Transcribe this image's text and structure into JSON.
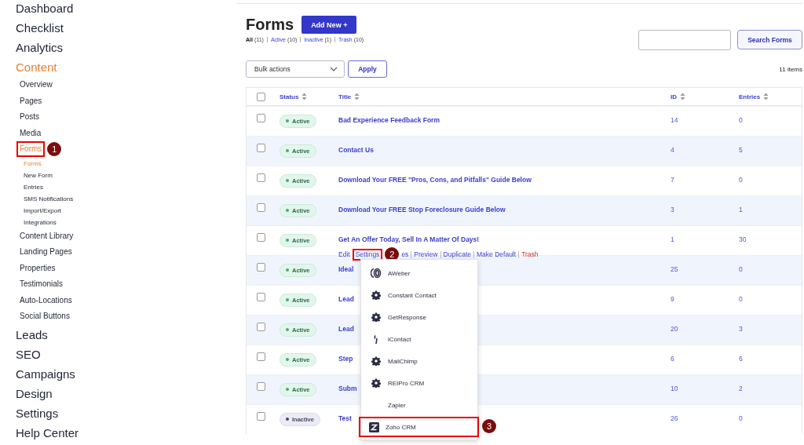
{
  "sidebar": {
    "items": [
      {
        "label": "Dashboard",
        "selected": false
      },
      {
        "label": "Checklist",
        "selected": false
      },
      {
        "label": "Analytics",
        "selected": false
      },
      {
        "label": "Content",
        "selected": true,
        "children": [
          {
            "label": "Overview",
            "selected": false
          },
          {
            "label": "Pages",
            "selected": false
          },
          {
            "label": "Posts",
            "selected": false
          },
          {
            "label": "Media",
            "selected": false
          },
          {
            "label": "Forms",
            "selected": true,
            "highlighted": true,
            "callout": "1",
            "children": [
              {
                "label": "Forms",
                "selected": true
              },
              {
                "label": "New Form",
                "selected": false
              },
              {
                "label": "Entries",
                "selected": false
              },
              {
                "label": "SMS Notifications",
                "selected": false
              },
              {
                "label": "Import/Export",
                "selected": false
              },
              {
                "label": "Integrations",
                "selected": false
              }
            ]
          },
          {
            "label": "Content Library",
            "selected": false
          },
          {
            "label": "Landing Pages",
            "selected": false
          },
          {
            "label": "Properties",
            "selected": false
          },
          {
            "label": "Testimonials",
            "selected": false
          },
          {
            "label": "Auto-Locations",
            "selected": false
          },
          {
            "label": "Social Buttons",
            "selected": false
          }
        ]
      },
      {
        "label": "Leads",
        "selected": false
      },
      {
        "label": "SEO",
        "selected": false
      },
      {
        "label": "Campaigns",
        "selected": false
      },
      {
        "label": "Design",
        "selected": false
      },
      {
        "label": "Settings",
        "selected": false
      },
      {
        "label": "Help Center",
        "selected": false
      }
    ]
  },
  "page": {
    "title": "Forms",
    "add_button": "Add New +"
  },
  "filters": [
    {
      "label": "All",
      "count": "(11)",
      "selected": true
    },
    {
      "label": "Active",
      "count": "(10)",
      "selected": false
    },
    {
      "label": "Inactive",
      "count": "(1)",
      "selected": false
    },
    {
      "label": "Trash",
      "count": "(10)",
      "selected": false
    }
  ],
  "search": {
    "button": "Search Forms"
  },
  "bulk": {
    "value": "Bulk actions",
    "apply": "Apply",
    "items_count": "11 items"
  },
  "table": {
    "select_all_checked": false,
    "columns": [
      "Status",
      "Title",
      "ID",
      "Entries"
    ],
    "rows": [
      {
        "checked": false,
        "status": "Active",
        "active": true,
        "title": "Bad Experience Feedback Form",
        "id": "14",
        "entries": "0"
      },
      {
        "checked": false,
        "status": "Active",
        "active": true,
        "title": "Contact Us",
        "id": "4",
        "entries": "5"
      },
      {
        "checked": false,
        "status": "Active",
        "active": true,
        "title": "Download Your FREE \"Pros, Cons, and Pitfalls\" Guide Below",
        "id": "7",
        "entries": "0"
      },
      {
        "checked": false,
        "status": "Active",
        "active": true,
        "title": "Download Your FREE Stop Foreclosure Guide Below",
        "id": "3",
        "entries": "1"
      },
      {
        "checked": false,
        "status": "Active",
        "active": true,
        "title": "Get An Offer Today, Sell In A Matter Of Days!",
        "id": "1",
        "entries": "30",
        "actions": [
          {
            "label": "Edit",
            "kind": "link"
          },
          {
            "label": "Settings",
            "kind": "link",
            "highlighted": true,
            "callout": "2"
          },
          {
            "label": "es",
            "kind": "link"
          },
          {
            "label": "Preview",
            "kind": "link"
          },
          {
            "label": "Duplicate",
            "kind": "link"
          },
          {
            "label": "Make Default",
            "kind": "link"
          },
          {
            "label": "Trash",
            "kind": "danger"
          }
        ]
      },
      {
        "checked": false,
        "status": "Active",
        "active": true,
        "title": "Ideal",
        "id": "25",
        "entries": "0"
      },
      {
        "checked": false,
        "status": "Active",
        "active": true,
        "title": "Lead",
        "id": "9",
        "entries": "0"
      },
      {
        "checked": false,
        "status": "Active",
        "active": true,
        "title": "Lead",
        "id": "20",
        "entries": "3"
      },
      {
        "checked": false,
        "status": "Active",
        "active": true,
        "title": "Step",
        "id": "6",
        "entries": "6"
      },
      {
        "checked": false,
        "status": "Active",
        "active": true,
        "title": "Subm",
        "id": "10",
        "entries": "2"
      },
      {
        "checked": false,
        "status": "Inactive",
        "active": false,
        "title": "Test",
        "id": "26",
        "entries": "0"
      }
    ]
  },
  "settings_menu": [
    {
      "label": "AWeber",
      "kind": "aweber",
      "highlighted": false
    },
    {
      "label": "Constant Contact",
      "kind": "gear",
      "highlighted": false
    },
    {
      "label": "GetResponse",
      "kind": "gear",
      "highlighted": false
    },
    {
      "label": "iContact",
      "kind": "icontact",
      "highlighted": false
    },
    {
      "label": "MailChimp",
      "kind": "gear",
      "highlighted": false
    },
    {
      "label": "REIPro CRM",
      "kind": "gear",
      "highlighted": false
    },
    {
      "label": "Zapier",
      "kind": "none",
      "highlighted": false
    },
    {
      "label": "Zoho CRM",
      "kind": "zoho",
      "highlighted": true,
      "callout": "3"
    }
  ]
}
